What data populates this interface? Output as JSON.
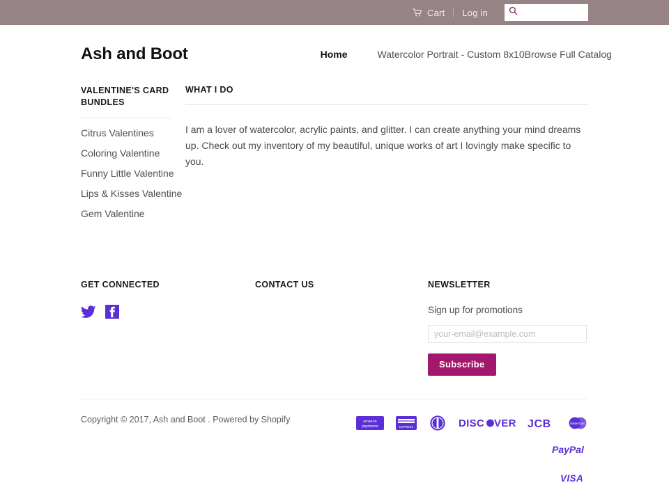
{
  "topbar": {
    "cart_label": "Cart",
    "cart_icon": "shopping-cart-icon",
    "login_label": "Log in",
    "search_icon": "search-icon",
    "search_value": "",
    "search_placeholder": "",
    "background_color": "#958386"
  },
  "header": {
    "logo": "Ash and Boot",
    "nav": [
      {
        "label": "Home",
        "active": true
      },
      {
        "label": "Watercolor Portrait - Custom 8x10",
        "active": false
      },
      {
        "label": "Browse Full Catalog",
        "active": false
      }
    ]
  },
  "sidebar": {
    "title": "Valentine's Card Bundles",
    "items": [
      {
        "label": "Citrus Valentines"
      },
      {
        "label": "Coloring Valentine"
      },
      {
        "label": "Funny Little Valentine"
      },
      {
        "label": "Lips & Kisses Valentine"
      },
      {
        "label": "Gem Valentine"
      }
    ]
  },
  "main": {
    "title": "What I Do",
    "paragraph": "I am a lover of watercolor, acrylic paints, and glitter. I can create anything your mind dreams up. Check out my inventory of my beautiful, unique works of art I lovingly make specific to you."
  },
  "footer": {
    "connected": {
      "title": "Get Connected",
      "social": [
        {
          "name": "twitter-icon",
          "label": "Twitter"
        },
        {
          "name": "facebook-icon",
          "label": "Facebook"
        }
      ],
      "icon_color": "#5b2fd6"
    },
    "contact": {
      "title": "Contact Us"
    },
    "newsletter": {
      "title": "Newsletter",
      "subtitle": "Sign up for promotions",
      "email_value": "",
      "email_placeholder": "your-email@example.com",
      "subscribe_label": "Subscribe",
      "button_color": "#a3176d"
    }
  },
  "bottom": {
    "copyright": "Copyright © 2017, Ash and Boot . Powered by Shopify",
    "payments": [
      {
        "name": "amazon-payments-icon",
        "label": "amazon payments"
      },
      {
        "name": "american-express-icon",
        "label": "AMERICAN EXPRESS"
      },
      {
        "name": "diners-club-icon",
        "label": "Diners Club"
      },
      {
        "name": "discover-icon",
        "label": "DISCOVER"
      },
      {
        "name": "jcb-icon",
        "label": "JCB"
      },
      {
        "name": "mastercard-icon",
        "label": "MasterCard"
      },
      {
        "name": "paypal-icon",
        "label": "PayPal"
      },
      {
        "name": "visa-icon",
        "label": "VISA"
      }
    ],
    "payment_color": "#5b2fd6"
  }
}
